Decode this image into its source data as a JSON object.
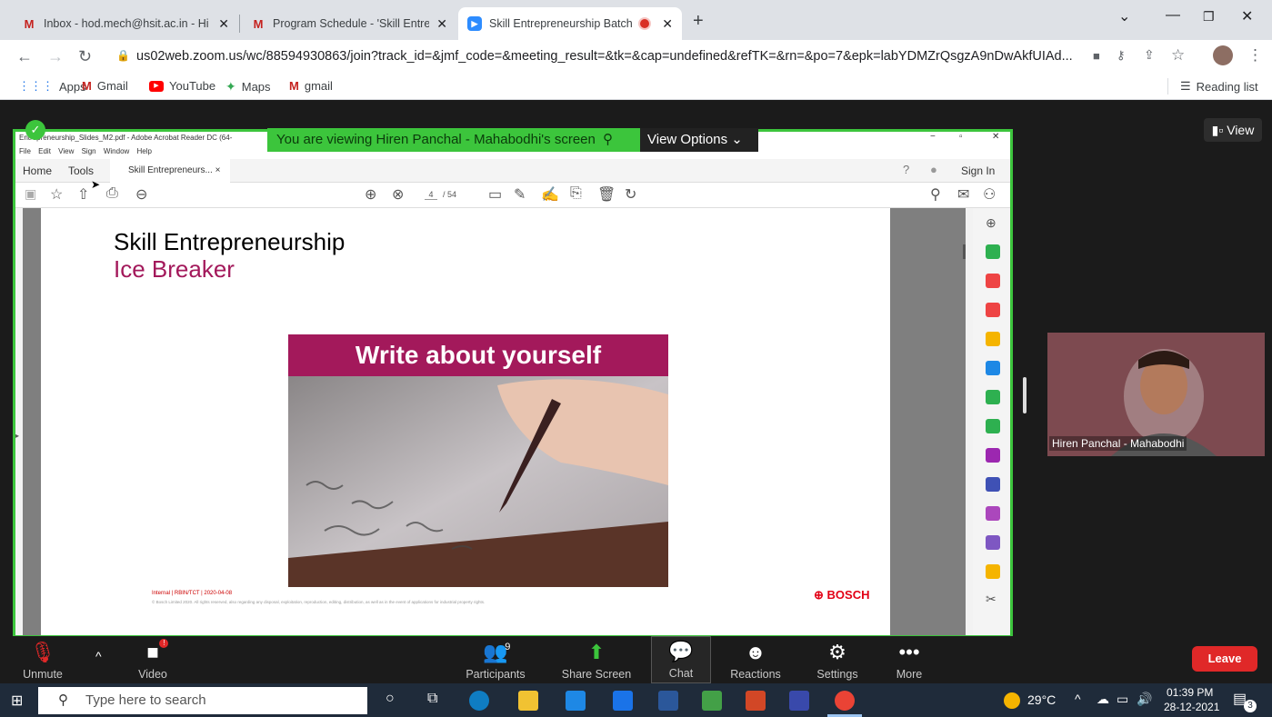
{
  "browser": {
    "tabs": [
      {
        "title": "Inbox - hod.mech@hsit.ac.in - Hi",
        "icon": "gmail-icon",
        "close": "✕"
      },
      {
        "title": "Program Schedule - 'Skill Entrepr",
        "icon": "gmail-icon",
        "close": "✕"
      },
      {
        "title": "Skill Entrepreneurship Batch",
        "icon": "zoom-icon",
        "close": "✕"
      }
    ],
    "new_tab": "+",
    "url": "us02web.zoom.us/wc/88594930863/join?track_id=&jmf_code=&meeting_result=&tk=&cap=undefined&refTK=&rn=&po=7&epk=labYDMZrQsgzA9nDwAkfUIAd...",
    "bookmarks": [
      "Apps",
      "Gmail",
      "YouTube",
      "Maps",
      "gmail"
    ],
    "reading_list": "Reading list"
  },
  "acrobat": {
    "title": "Entrepreneurship_Slides_M2.pdf - Adobe Acrobat Reader DC (64-",
    "menu": [
      "File",
      "Edit",
      "View",
      "Sign",
      "Window",
      "Help"
    ],
    "tabs": [
      "Home",
      "Tools",
      "Skill Entrepreneurs...  ×"
    ],
    "sign_in": "Sign In",
    "page_current": "4",
    "page_total": "/ 54"
  },
  "slide": {
    "title": "Skill Entrepreneurship",
    "subtitle": "Ice Breaker",
    "banner": "Write about yourself",
    "footer_internal": "Internal | RBIN/TCT | 2020-04-08",
    "footer_copyright": "© Bosch Limited 2020. All rights reserved, also regarding any disposal, exploitation, reproduction, editing, distribution, as well as in the event of applications for industrial property rights.",
    "brand": "BOSCH"
  },
  "zoom": {
    "viewing_banner": "You are viewing Hiren Panchal - Mahabodhi's screen",
    "view_options": "View Options",
    "view_button": "View",
    "participant_name": "Hiren Panchal - Mahabodhi",
    "participants_count": "9",
    "controls": {
      "unmute": "Unmute",
      "video": "Video",
      "participants": "Participants",
      "share_screen": "Share Screen",
      "chat": "Chat",
      "reactions": "Reactions",
      "settings": "Settings",
      "more": "More",
      "leave": "Leave"
    }
  },
  "taskbar": {
    "search_placeholder": "Type here to search",
    "weather": "29°C",
    "time": "01:39 PM",
    "date": "28-12-2021",
    "notification_count": "3"
  },
  "colors": {
    "share_border": "#3cc53c",
    "slide_accent": "#a3195b",
    "leave": "#e02828",
    "bosch_red": "#e20015"
  }
}
